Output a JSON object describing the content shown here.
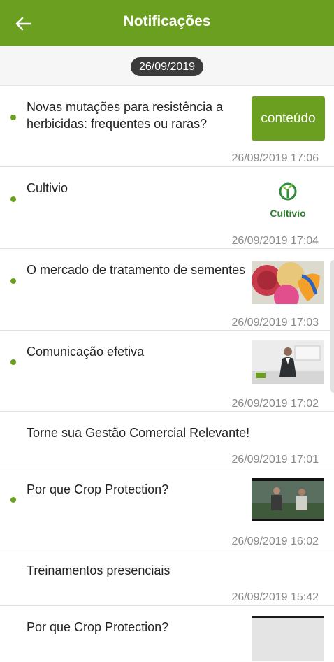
{
  "appbar": {
    "title": "Notificações",
    "back_icon": "arrow-left-icon",
    "color": "#6a9f1f"
  },
  "date_header": "26/09/2019",
  "notifications": [
    {
      "title": "Novas mutações para resistência a herbicidas: frequentes ou raras?",
      "time": "26/09/2019 17:06",
      "unread": true,
      "action_label": "conteúdo"
    },
    {
      "title": "Cultivio",
      "time": "26/09/2019 17:04",
      "unread": true,
      "thumb_logo_text": "Cultivio"
    },
    {
      "title": "O mercado de tratamento de sementes",
      "time": "26/09/2019 17:03",
      "unread": true
    },
    {
      "title": "Comunicação efetiva",
      "time": "26/09/2019 17:02",
      "unread": true
    },
    {
      "title": "Torne sua Gestão Comercial Relevante!",
      "time": "26/09/2019 17:01",
      "unread": false
    },
    {
      "title": "Por que Crop Protection?",
      "time": "26/09/2019 16:02",
      "unread": true
    },
    {
      "title": "Treinamentos presenciais",
      "time": "26/09/2019 15:42",
      "unread": false
    },
    {
      "title": "Por que Crop Protection?",
      "unread": false
    }
  ]
}
